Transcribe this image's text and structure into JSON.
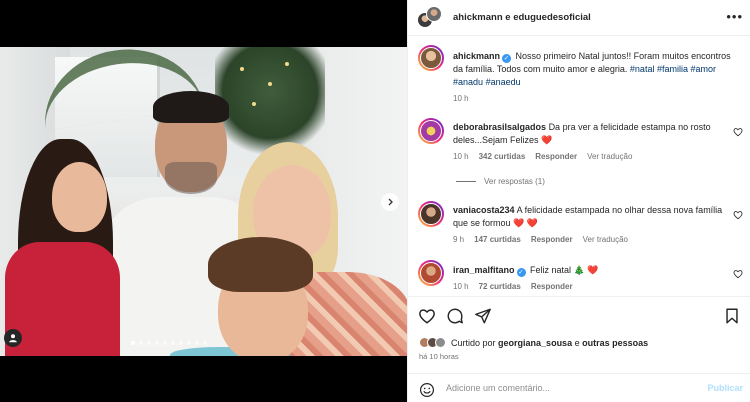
{
  "header": {
    "title": "ahickmann e eduguedesoficial",
    "more_icon": "more-horizontal-icon"
  },
  "media": {
    "next_icon": "chevron-right-icon",
    "carousel_dots": 10,
    "active_dot": 0,
    "tags_icon": "user-tag-icon"
  },
  "caption": {
    "username": "ahickmann",
    "verified": true,
    "text": "Nosso primeiro Natal juntos!! Foram muitos encontros da família. Todos com muito amor e alegria. ",
    "hashtags": [
      "#natal",
      "#familia",
      "#amor",
      "#anadu",
      "#anaedu"
    ],
    "time": "10 h"
  },
  "comments": [
    {
      "username": "deborabrasilsalgados",
      "verified": false,
      "text": "Da pra ver a felicidade estampa no rosto deles...Sejam Felizes",
      "emoji": "❤️",
      "time": "10 h",
      "likes": "342 curtidas",
      "reply": "Responder",
      "translate": "Ver tradução",
      "view_replies": "Ver respostas (1)"
    },
    {
      "username": "vaniacosta234",
      "verified": false,
      "text": "A felicidade estampada no olhar dessa nova família que se formou",
      "emoji": "❤️ ❤️",
      "time": "9 h",
      "likes": "147 curtidas",
      "reply": "Responder",
      "translate": "Ver tradução"
    },
    {
      "username": "iran_malfitano",
      "verified": true,
      "text": "Feliz natal",
      "emoji": "🎄 ❤️",
      "time": "10 h",
      "likes": "72 curtidas",
      "reply": "Responder"
    }
  ],
  "actions": {
    "like_icon": "heart-icon",
    "comment_icon": "comment-icon",
    "share_icon": "send-icon",
    "save_icon": "bookmark-icon"
  },
  "likes_summary": {
    "prefix": "Curtido por",
    "user": "georgiana_sousa",
    "conjunction": "e",
    "others": "outras pessoas",
    "time_ago": "há 10 horas"
  },
  "composer": {
    "emoji_icon": "emoji-icon",
    "placeholder": "Adicione um comentário...",
    "post_label": "Publicar"
  },
  "colors": {
    "link": "#00376b",
    "verified": "#3897f0",
    "heart_red": "#ed4956",
    "muted": "#737373",
    "post_disabled": "#b2dffc"
  }
}
